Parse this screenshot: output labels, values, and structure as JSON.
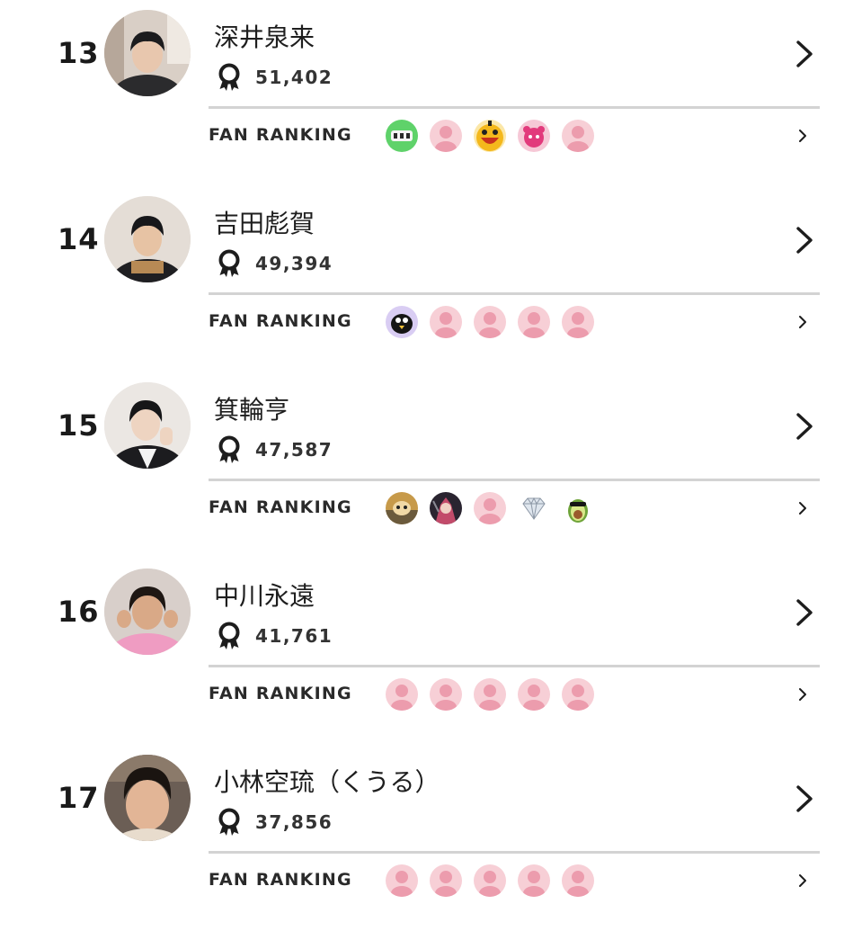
{
  "list": {
    "fan_ranking_label": "FAN RANKING",
    "entries": [
      {
        "rank": "13",
        "name": "深井泉来",
        "score": "51,402",
        "fans": [
          "green-sticker-fan-icon",
          "default-pink-user-icon",
          "yellow-mascot-fan-icon",
          "pink-creature-fan-icon",
          "default-pink-user-icon"
        ]
      },
      {
        "rank": "14",
        "name": "吉田彪賀",
        "score": "49,394",
        "fans": [
          "black-bird-fan-icon",
          "default-pink-user-icon",
          "default-pink-user-icon",
          "default-pink-user-icon",
          "default-pink-user-icon"
        ]
      },
      {
        "rank": "15",
        "name": "箕輪亨",
        "score": "47,587",
        "fans": [
          "dog-photo-fan-icon",
          "anime-character-fan-icon",
          "default-pink-user-icon",
          "diamond-fan-icon",
          "avocado-sunglasses-fan-icon"
        ]
      },
      {
        "rank": "16",
        "name": "中川永遠",
        "score": "41,761",
        "fans": [
          "default-pink-user-icon",
          "default-pink-user-icon",
          "default-pink-user-icon",
          "default-pink-user-icon",
          "default-pink-user-icon"
        ]
      },
      {
        "rank": "17",
        "name": "小林空琉（くうる）",
        "score": "37,856",
        "fans": [
          "default-pink-user-icon",
          "default-pink-user-icon",
          "default-pink-user-icon",
          "default-pink-user-icon",
          "default-pink-user-icon"
        ]
      }
    ]
  },
  "colors": {
    "default_avatar_bg": "#f7cfd6",
    "default_avatar_fg": "#ec9cad",
    "divider": "#d3d3d3",
    "text": "#222222"
  }
}
